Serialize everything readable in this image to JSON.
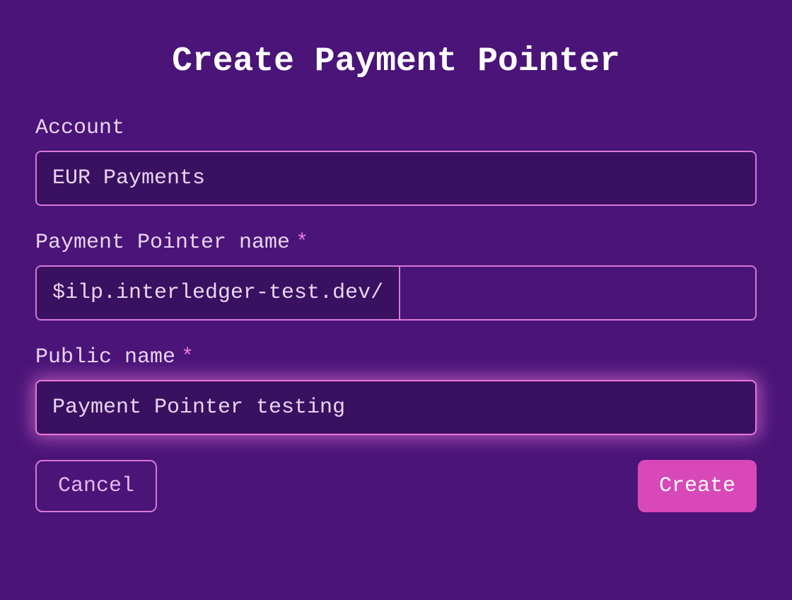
{
  "title": "Create Payment Pointer",
  "form": {
    "account": {
      "label": "Account",
      "value": "EUR Payments"
    },
    "pointerName": {
      "label": "Payment Pointer name",
      "required": "*",
      "prefix": "$ilp.interledger-test.dev/",
      "value": ""
    },
    "publicName": {
      "label": "Public name",
      "required": "*",
      "value": "Payment Pointer testing"
    }
  },
  "buttons": {
    "cancel": "Cancel",
    "create": "Create"
  }
}
